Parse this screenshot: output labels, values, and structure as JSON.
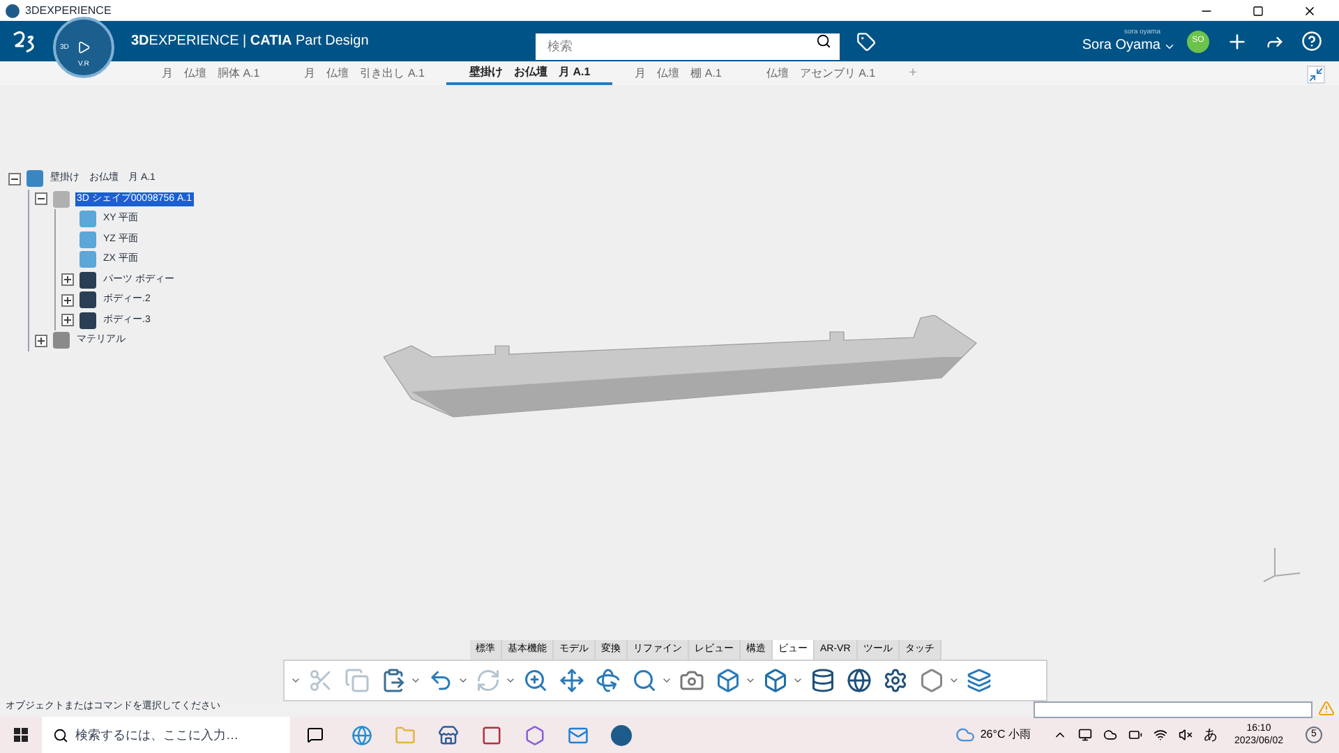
{
  "window": {
    "title": "3DEXPERIENCE"
  },
  "header": {
    "title": "**3D**EXPERIENCE | **CATIA** Part Design",
    "compass": {
      "left": "3D",
      "bottom": "V.R"
    },
    "search": {
      "placeholder": "検索"
    },
    "user": {
      "login": "sora oyama",
      "name": "Sora Oyama",
      "initials": "SO"
    }
  },
  "doc_tabs": [
    {
      "label": "月　仏壇　胴体 A.1",
      "selected": false
    },
    {
      "label": "月　仏壇　引き出し A.1",
      "selected": false
    },
    {
      "label": "壁掛け　お仏壇　月 A.1",
      "selected": true
    },
    {
      "label": "月　仏壇　棚 A.1",
      "selected": false
    },
    {
      "label": "仏壇　アセンブリ A.1",
      "selected": false
    }
  ],
  "add_tab": "+",
  "tree": [
    {
      "label": "壁掛け　お仏壇　月 A.1",
      "kind": "product",
      "selected": false,
      "expanded": true,
      "children": [
        {
          "label": "3D シェイプ00098756 A.1",
          "kind": "shape",
          "selected": true,
          "expanded": true,
          "children": [
            {
              "label": "XY 平面",
              "kind": "plane",
              "selected": false
            },
            {
              "label": "YZ 平面",
              "kind": "plane",
              "selected": false
            },
            {
              "label": "ZX 平面",
              "kind": "plane",
              "selected": false
            },
            {
              "label": "パーツ ボディー",
              "kind": "body",
              "selected": false,
              "expanded": false
            },
            {
              "label": "ボディー.2",
              "kind": "body",
              "selected": false,
              "expanded": false
            },
            {
              "label": "ボディー.3",
              "kind": "body",
              "selected": false,
              "expanded": false
            }
          ]
        },
        {
          "label": "マテリアル",
          "kind": "material",
          "selected": false,
          "expanded": false
        }
      ]
    }
  ],
  "toolbar_tabs": [
    {
      "label": "標準",
      "selected": false
    },
    {
      "label": "基本機能",
      "selected": false
    },
    {
      "label": "モデル",
      "selected": false
    },
    {
      "label": "変換",
      "selected": false
    },
    {
      "label": "リファイン",
      "selected": false
    },
    {
      "label": "レビュー",
      "selected": false
    },
    {
      "label": "構造",
      "selected": false
    },
    {
      "label": "ビュー",
      "selected": true
    },
    {
      "label": "AR-VR",
      "selected": false
    },
    {
      "label": "ツール",
      "selected": false
    },
    {
      "label": "タッチ",
      "selected": false
    }
  ],
  "status_bar": {
    "message": "オブジェクトまたはコマンドを選択してください"
  },
  "taskbar": {
    "search_placeholder": "検索するには、ここに入力…",
    "weather": "26°C 小雨",
    "ime": "あ",
    "time": "16:10",
    "date": "2023/06/02",
    "notifications": "5"
  }
}
